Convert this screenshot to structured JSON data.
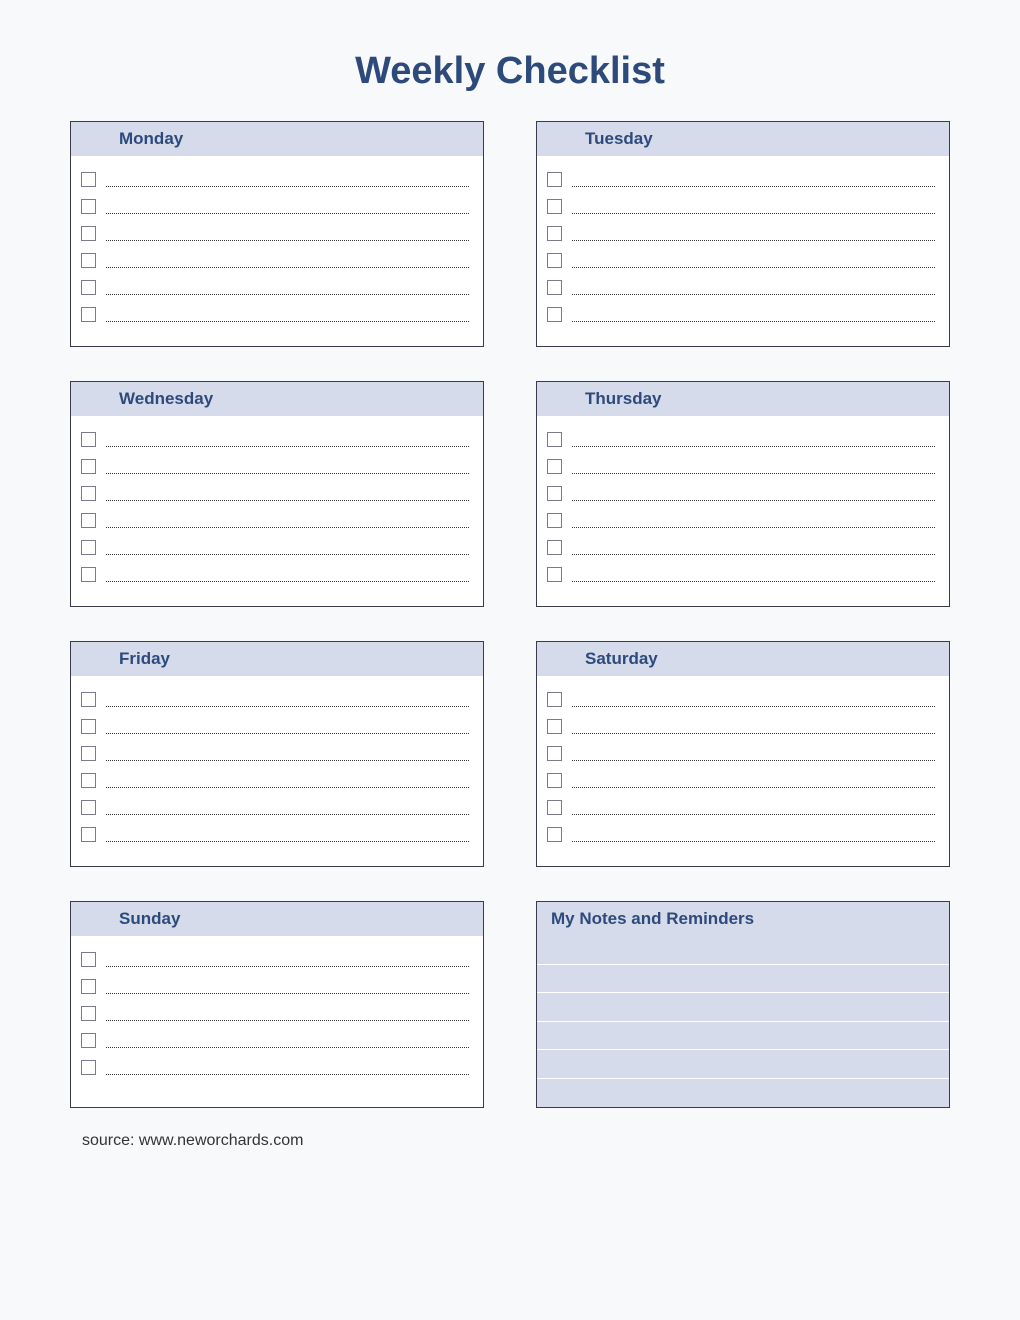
{
  "title": "Weekly Checklist",
  "days": {
    "monday": "Monday",
    "tuesday": "Tuesday",
    "wednesday": "Wednesday",
    "thursday": "Thursday",
    "friday": "Friday",
    "saturday": "Saturday",
    "sunday": "Sunday"
  },
  "notes_header": "My Notes and Reminders",
  "source": "source: www.neworchards.com",
  "checklist_rows_per_day": 6,
  "sunday_rows": 5,
  "notes_rows": 6
}
